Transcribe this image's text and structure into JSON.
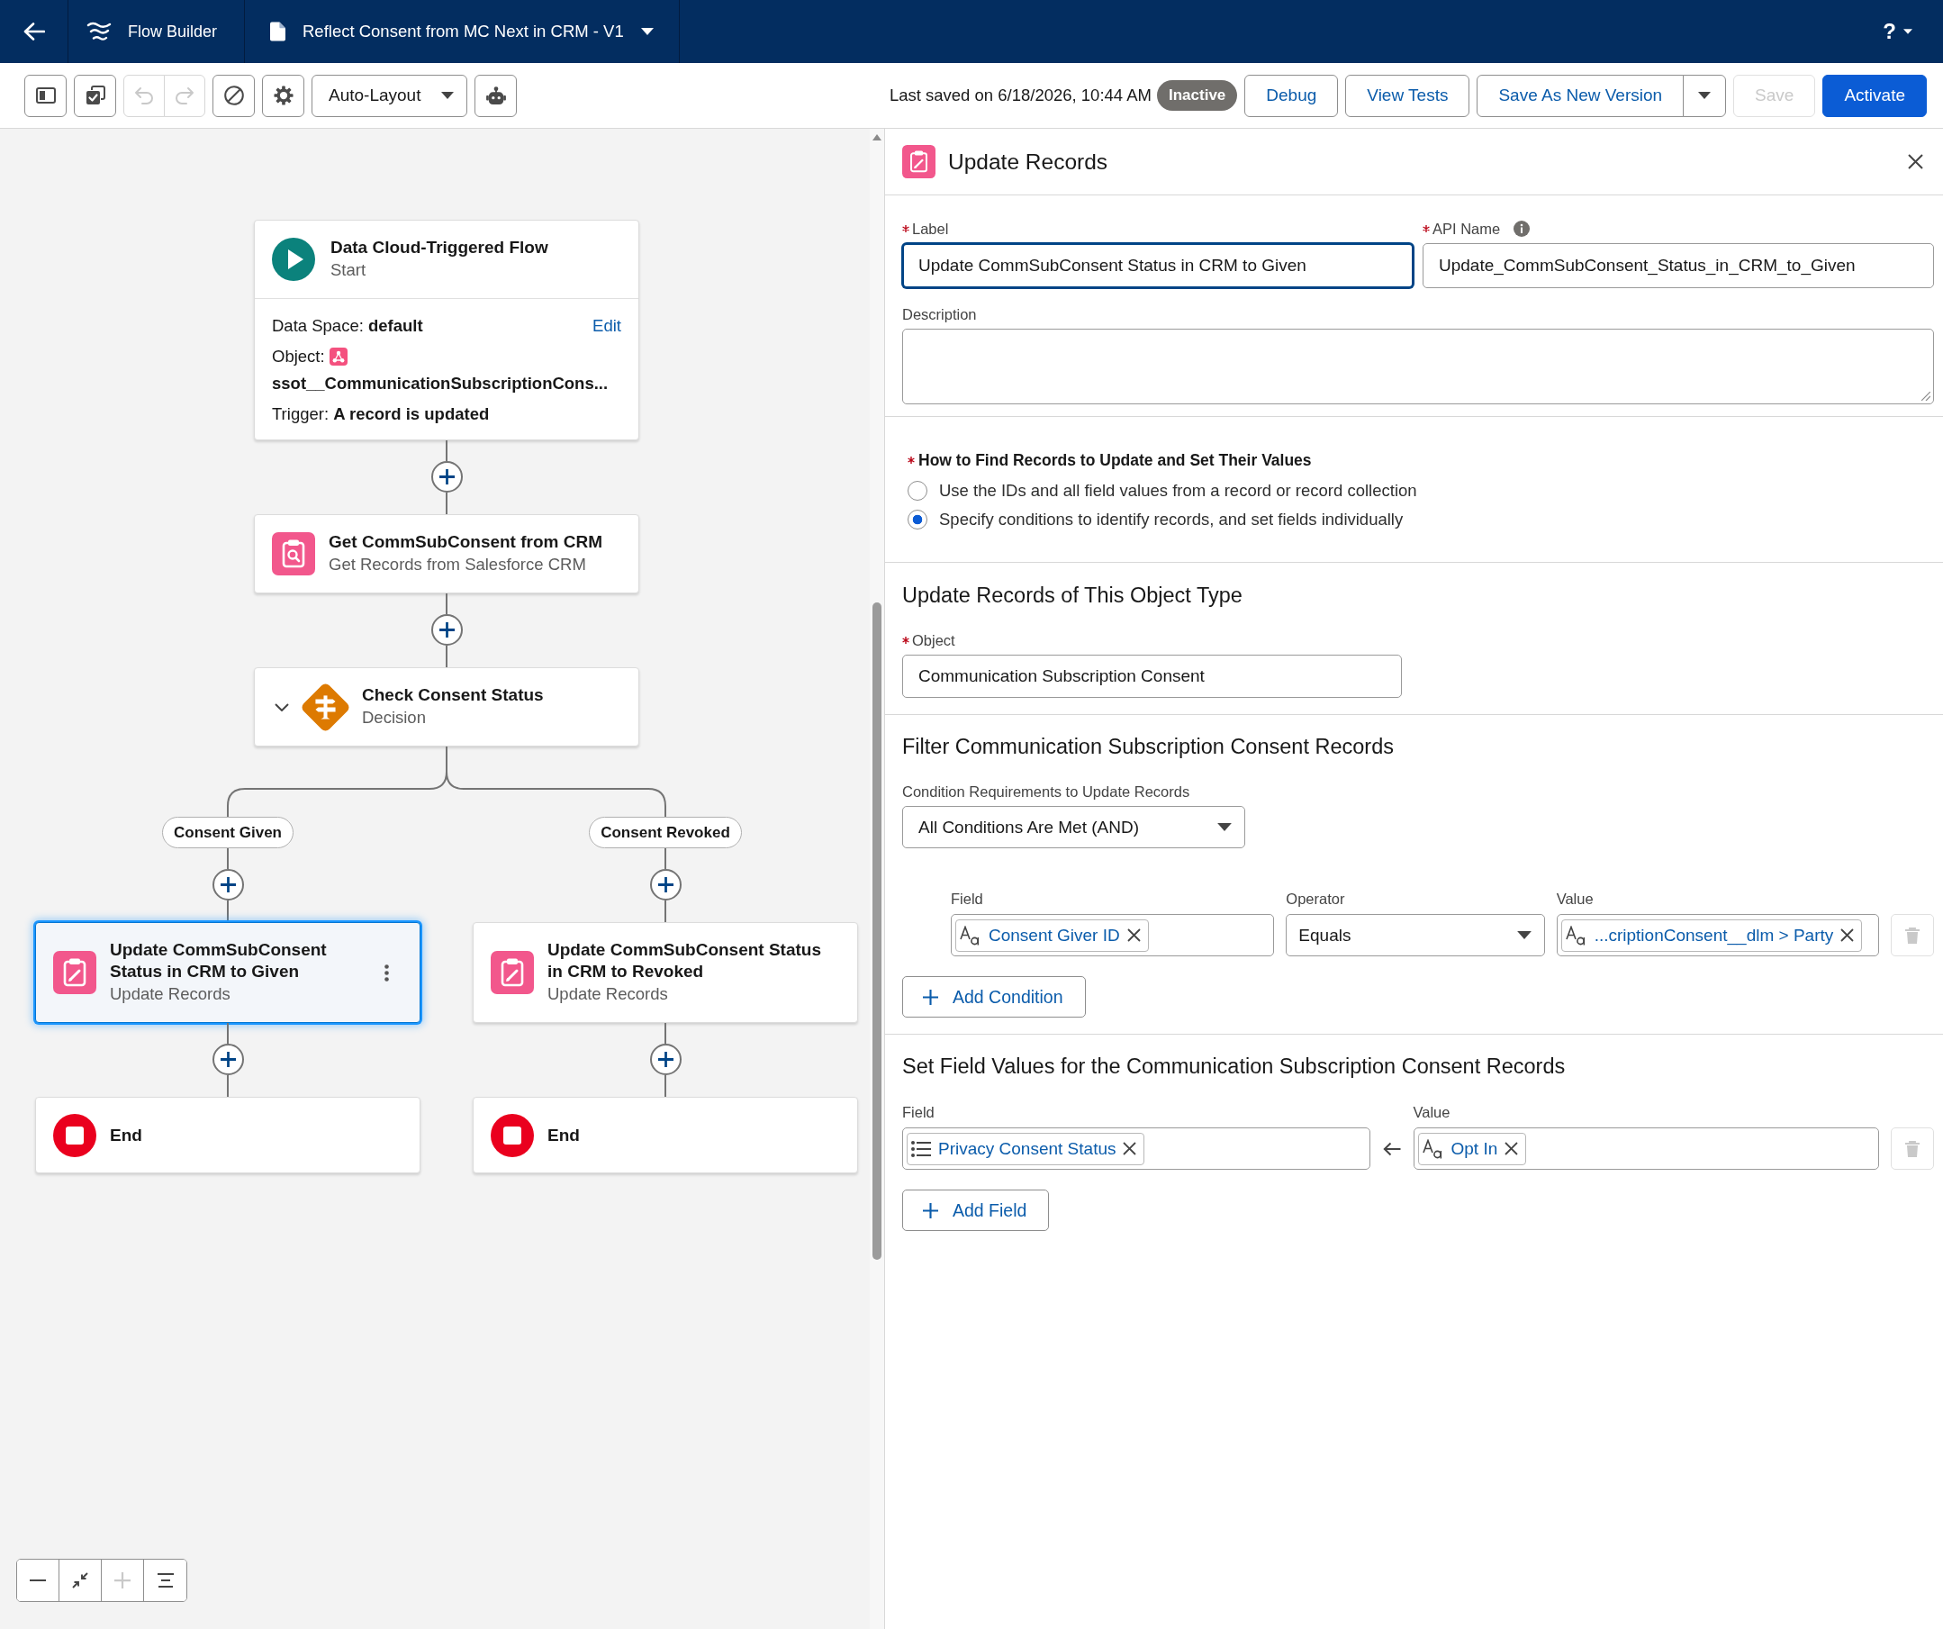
{
  "header": {
    "app_name": "Flow Builder",
    "flow_title": "Reflect Consent from MC Next in CRM - V1",
    "help": "?"
  },
  "toolbar": {
    "tools": [
      {
        "kind": "sidebar",
        "disabled": false
      },
      {
        "kind": "checklist",
        "disabled": false
      },
      {
        "kind": "undo",
        "disabled": true
      },
      {
        "kind": "redo",
        "disabled": true
      },
      {
        "kind": "block",
        "disabled": false
      },
      {
        "kind": "settings",
        "disabled": false
      },
      {
        "kind": "menu",
        "label": "Auto-Layout",
        "disabled": false
      },
      {
        "kind": "bot",
        "disabled": false
      }
    ],
    "last_saved": "Last saved on 6/18/2026, 10:44 AM",
    "status": "Inactive",
    "actions": [
      {
        "kind": "neutral",
        "label": "Debug",
        "disabled": false
      },
      {
        "kind": "neutral",
        "label": "View Tests",
        "disabled": false
      },
      {
        "kind": "split",
        "label": "Save As New Version",
        "disabled": false
      },
      {
        "kind": "neutral",
        "label": "Save",
        "disabled": true
      },
      {
        "kind": "brand",
        "label": "Activate",
        "disabled": false
      }
    ]
  },
  "canvas": {
    "start": {
      "title": "Data Cloud-Triggered Flow",
      "type_label": "Start",
      "selected": false,
      "details": [
        {
          "kind": "inline",
          "label": "Data Space:",
          "value": "default",
          "link": "Edit"
        },
        {
          "kind": "object",
          "label": "Object:",
          "value": "ssot__CommunicationSubscriptionCons..."
        },
        {
          "kind": "inline",
          "label": "Trigger:",
          "value": "A record is updated"
        }
      ]
    },
    "nodes": [
      {
        "kind": "get_records",
        "title": "Get CommSubConsent from CRM",
        "type_label": "Get Records from Salesforce CRM",
        "selected": false
      },
      {
        "kind": "decision",
        "title": "Check Consent Status",
        "type_label": "Decision",
        "expanded": true,
        "selected": false
      }
    ],
    "branches": [
      {
        "label": "Consent Given",
        "nodes": [
          {
            "kind": "update_records",
            "title": "Update CommSubConsent Status in CRM to Given",
            "type_label": "Update Records",
            "selected": true
          },
          {
            "kind": "end",
            "title": "End",
            "selected": false
          }
        ]
      },
      {
        "label": "Consent Revoked",
        "nodes": [
          {
            "kind": "update_records",
            "title": "Update CommSubConsent Status in CRM to Revoked",
            "type_label": "Update Records",
            "selected": false
          },
          {
            "kind": "end",
            "title": "End",
            "selected": false
          }
        ]
      }
    ],
    "zoom_controls": [
      {
        "kind": "zoom_out",
        "disabled": false
      },
      {
        "kind": "fit",
        "disabled": false
      },
      {
        "kind": "zoom_in",
        "disabled": true
      },
      {
        "kind": "center",
        "disabled": false
      }
    ]
  },
  "panel": {
    "title": "Update Records",
    "label_field": {
      "label": "Label",
      "required": true,
      "value": "Update CommSubConsent Status in CRM to Given",
      "focused": true
    },
    "api_name_field": {
      "label": "API Name",
      "required": true,
      "value": "Update_CommSubConsent_Status_in_CRM_to_Given"
    },
    "description_field": {
      "label": "Description"
    },
    "how_to_find": {
      "label": "How to Find Records to Update and Set Their Values",
      "required": true,
      "options": [
        {
          "label": "Use the IDs and all field values from a record or record collection",
          "selected": false
        },
        {
          "label": "Specify conditions to identify records, and set fields individually",
          "selected": true
        }
      ]
    },
    "object_section": {
      "heading": "Update Records of This Object Type",
      "field": {
        "label": "Object",
        "required": true,
        "value": "Communication Subscription Consent"
      }
    },
    "filter_section": {
      "heading": "Filter Communication Subscription Consent Records",
      "requirement_label": "Condition Requirements to Update Records",
      "requirement": "All Conditions Are Met (AND)",
      "column_labels": [
        "Field",
        "Operator",
        "Value"
      ],
      "conditions": [
        {
          "field": {
            "kind": "text",
            "text": "Consent Giver ID"
          },
          "operator": "Equals",
          "value": {
            "kind": "text",
            "text": "...criptionConsent__dlm > Party"
          },
          "delete_disabled": true
        }
      ],
      "add_button": "Add Condition"
    },
    "assign_section": {
      "heading": "Set Field Values for the Communication Subscription Consent Records",
      "column_labels": [
        "Field",
        "Value"
      ],
      "assignments": [
        {
          "field": {
            "kind": "picklist",
            "text": "Privacy Consent Status"
          },
          "value": {
            "kind": "text",
            "text": "Opt In"
          },
          "delete_disabled": true
        }
      ],
      "add_button": "Add Field"
    }
  }
}
